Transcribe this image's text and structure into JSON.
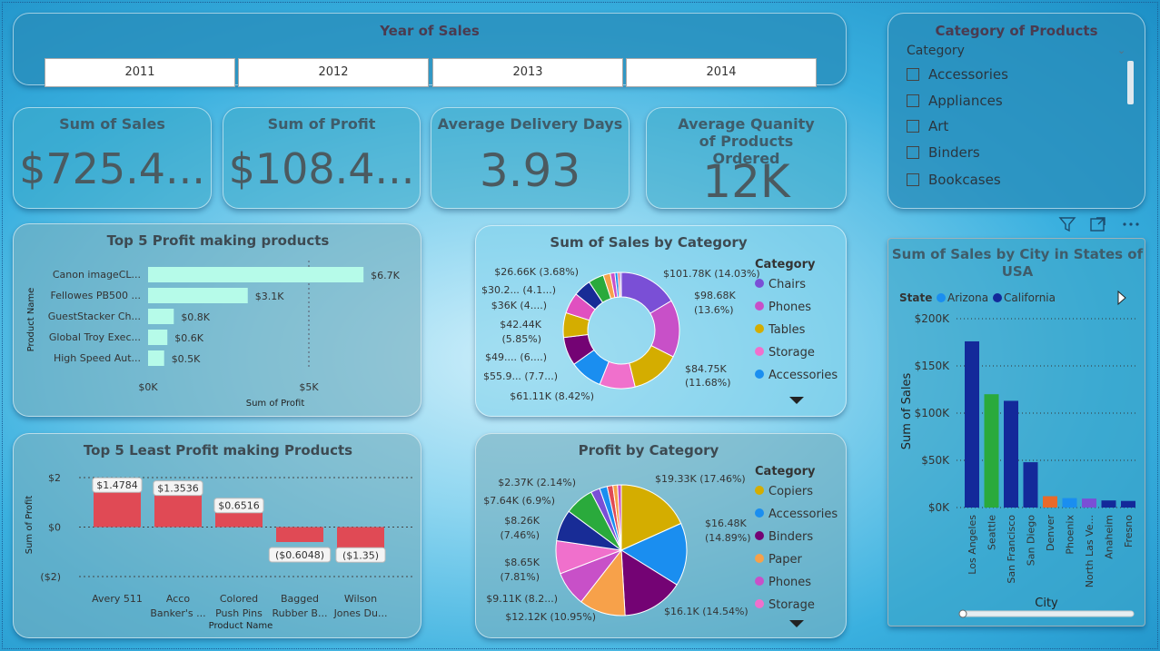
{
  "year_slicer": {
    "title": "Year of Sales",
    "years": [
      "2011",
      "2012",
      "2013",
      "2014"
    ]
  },
  "category_slicer": {
    "title": "Category of Products",
    "header": "Category",
    "items": [
      "Accessories",
      "Appliances",
      "Art",
      "Binders",
      "Bookcases"
    ]
  },
  "kpis": [
    {
      "title": "Sum of Sales",
      "value": "$725.4..."
    },
    {
      "title": "Sum of Profit",
      "value": "$108.4..."
    },
    {
      "title": "Average Delivery Days",
      "value": "3.93"
    },
    {
      "title": "Average Quanity of Products Ordered",
      "value": "12K"
    }
  ],
  "colors": {
    "bar_cyan": "#b6fbe9",
    "bar_red": "#e04a55",
    "navy": "#13299a",
    "green": "#2aaa3c"
  },
  "toolbar_icons": [
    "filter-icon",
    "focus-mode-icon",
    "more-options-icon"
  ],
  "chart_data": [
    {
      "id": "top5",
      "type": "bar",
      "orientation": "horizontal",
      "title": "Top 5 Profit making products",
      "categories": [
        "Canon imageCL...",
        "Fellowes PB500 ...",
        "GuestStacker Ch...",
        "Global Troy Exec...",
        "High Speed Aut..."
      ],
      "values": [
        6700,
        3100,
        800,
        600,
        500
      ],
      "data_labels": [
        "$6.7K",
        "$3.1K",
        "$0.8K",
        "$0.6K",
        "$0.5K"
      ],
      "xlabel": "Sum of Profit",
      "ylabel": "Product Name",
      "ticks": [
        "$0K",
        "$5K"
      ],
      "xlim": [
        0,
        10000
      ]
    },
    {
      "id": "least5",
      "type": "bar",
      "title": "Top 5 Least Profit making Products",
      "categories": [
        "Avery 511",
        "Acco Banker's ...",
        "Colored Push Pins",
        "Bagged Rubber B...",
        "Wilson Jones Du..."
      ],
      "category_lines": [
        [
          "Avery 511"
        ],
        [
          "Acco",
          "Banker's ..."
        ],
        [
          "Colored",
          "Push Pins"
        ],
        [
          "Bagged",
          "Rubber B..."
        ],
        [
          "Wilson",
          "Jones Du..."
        ]
      ],
      "values": [
        1.4784,
        1.3536,
        0.6516,
        -0.6048,
        -1.35
      ],
      "data_labels": [
        "$1.4784",
        "$1.3536",
        "$0.6516",
        "($0.6048)",
        "($1.35)"
      ],
      "xlabel": "Product Name",
      "ylabel": "Sum of Profit",
      "ticks": [
        "$2",
        "$0",
        "($2)"
      ],
      "ylim": [
        -2,
        2
      ]
    },
    {
      "id": "salescat",
      "type": "pie",
      "donut": true,
      "title": "Sum of Sales by Category",
      "legend_title": "Category",
      "legend": [
        "Chairs",
        "Phones",
        "Tables",
        "Storage",
        "Accessories"
      ],
      "slices": [
        {
          "name": "Chairs",
          "value": 101.78,
          "color": "#7a4fd6"
        },
        {
          "name": "Phones",
          "value": 98.68,
          "color": "#c850c8"
        },
        {
          "name": "Tables",
          "value": 84.75,
          "color": "#d4ad00"
        },
        {
          "name": "Storage",
          "value": 61.11,
          "color": "#f070cc"
        },
        {
          "name": "Accessories",
          "value": 55.9,
          "color": "#1a8ef0"
        },
        {
          "name": "",
          "value": 49.0,
          "color": "#740374"
        },
        {
          "name": "",
          "value": 42.44,
          "color": "#d4ad00"
        },
        {
          "name": "",
          "value": 36.0,
          "color": "#e050c0"
        },
        {
          "name": "",
          "value": 30.2,
          "color": "#182c96"
        },
        {
          "name": "",
          "value": 26.66,
          "color": "#2aaa3c"
        },
        {
          "name": "",
          "value": 12.0,
          "color": "#f7a14a"
        },
        {
          "name": "",
          "value": 8.0,
          "color": "#c850c8"
        },
        {
          "name": "",
          "value": 5.0,
          "color": "#1a8ef0"
        },
        {
          "name": "",
          "value": 3.5,
          "color": "#e04a55"
        },
        {
          "name": "",
          "value": 2.5,
          "color": "#7a4fd6"
        }
      ],
      "labels": [
        "$101.78K (14.03%)",
        "$98.68K",
        "(13.6%)",
        "$84.75K",
        "(11.68%)",
        "$61.11K (8.42%)",
        "$55.9... (7.7...)",
        "$49.... (6....)",
        "$42.44K",
        "(5.85%)",
        "$36K (4....)",
        "$30.2... (4.1...)",
        "$26.66K (3.68%)"
      ]
    },
    {
      "id": "profitcat",
      "type": "pie",
      "title": "Profit by Category",
      "legend_title": "Category",
      "legend": [
        "Copiers",
        "Accessories",
        "Binders",
        "Paper",
        "Phones",
        "Storage"
      ],
      "slices": [
        {
          "name": "Copiers",
          "value": 19.33,
          "color": "#d4ad00"
        },
        {
          "name": "Accessories",
          "value": 16.48,
          "color": "#1a8ef0"
        },
        {
          "name": "Binders",
          "value": 16.1,
          "color": "#740374"
        },
        {
          "name": "Paper",
          "value": 12.12,
          "color": "#f7a14a"
        },
        {
          "name": "Phones",
          "value": 9.11,
          "color": "#c850c8"
        },
        {
          "name": "Storage",
          "value": 8.65,
          "color": "#f070cc"
        },
        {
          "name": "",
          "value": 8.26,
          "color": "#182c96"
        },
        {
          "name": "",
          "value": 7.64,
          "color": "#2aaa3c"
        },
        {
          "name": "",
          "value": 2.37,
          "color": "#7a4fd6"
        },
        {
          "name": "",
          "value": 2.0,
          "color": "#1a8ef0"
        },
        {
          "name": "",
          "value": 1.5,
          "color": "#e04a55"
        },
        {
          "name": "",
          "value": 1.2,
          "color": "#f7a14a"
        },
        {
          "name": "",
          "value": 1.0,
          "color": "#c850c8"
        }
      ],
      "labels": [
        "$19.33K (17.46%)",
        "$16.48K",
        "(14.89%)",
        "$16.1K (14.54%)",
        "$12.12K (10.95%)",
        "$9.11K (8.2...)",
        "$8.65K",
        "(7.81%)",
        "$8.26K",
        "(7.46%)",
        "$7.64K (6.9%)",
        "$2.37K (2.14%)"
      ]
    },
    {
      "id": "city",
      "type": "bar",
      "title": "Sum of Sales by City in States of USA",
      "title_lines": [
        "Sum of Sales by City in States of",
        "USA"
      ],
      "legend_title": "State",
      "legend": [
        {
          "name": "Arizona",
          "color": "#1a8ef0"
        },
        {
          "name": "California",
          "color": "#13299a"
        }
      ],
      "categories": [
        "Los Angeles",
        "Seattle",
        "San Francisco",
        "San Diego",
        "Denver",
        "Phoenix",
        "North Las Ve...",
        "Anaheim",
        "Fresno"
      ],
      "values": [
        176000,
        120000,
        113000,
        48000,
        12000,
        10000,
        9500,
        7500,
        7000
      ],
      "colors": [
        "#13299a",
        "#2aaa3c",
        "#13299a",
        "#13299a",
        "#e86a2a",
        "#1a8ef0",
        "#7a4fd6",
        "#13299a",
        "#13299a"
      ],
      "xlabel": "City",
      "ylabel": "Sum of Sales",
      "ticks": [
        "$200K",
        "$150K",
        "$100K",
        "$50K",
        "$0K"
      ],
      "ylim": [
        0,
        200000
      ]
    }
  ]
}
